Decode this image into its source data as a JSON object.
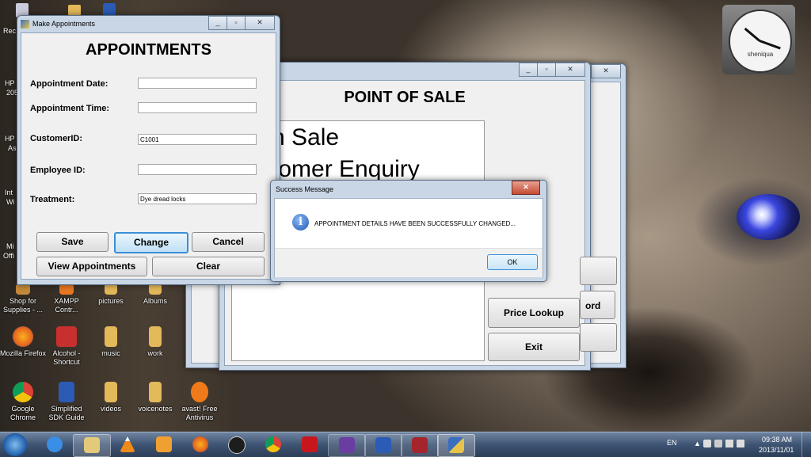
{
  "desktop": {
    "left_edge_labels": [
      "Rec",
      "HP",
      "205",
      "HP",
      "As",
      "Int",
      "Wi",
      "Mi",
      "Offi"
    ],
    "icons": [
      {
        "label": "Shop for Supplies - ...",
        "color": "#c58a3a"
      },
      {
        "label": "XAMPP Contr...",
        "color": "#e87722"
      },
      {
        "label": "pictures",
        "color": "#e3b95a"
      },
      {
        "label": "Albums",
        "color": "#e3b95a"
      },
      {
        "label": "Mozilla Firefox",
        "color": "#e8661e"
      },
      {
        "label": "Alcohol - Shortcut",
        "color": "#c83030"
      },
      {
        "label": "music",
        "color": "#e3b95a"
      },
      {
        "label": "work",
        "color": "#e3b95a"
      },
      {
        "label": "Google Chrome",
        "color": "#3a9a3a"
      },
      {
        "label": "Simplified SDK Guide",
        "color": "#2b5bb5"
      },
      {
        "label": "videos",
        "color": "#e3b95a"
      },
      {
        "label": "voicenotes",
        "color": "#e3b95a"
      },
      {
        "label": "avast! Free Antivirus",
        "color": "#f07a1a"
      }
    ],
    "clock_gadget_label": "sheniqua"
  },
  "appointments_window": {
    "title": "Make Appointments",
    "heading": "APPOINTMENTS",
    "fields": {
      "appointment_date": {
        "label": "Appointment Date:",
        "value": ""
      },
      "appointment_time": {
        "label": "Appointment Time:",
        "value": ""
      },
      "customer_id": {
        "label": "CustomerID:",
        "value": "C1001"
      },
      "employee_id": {
        "label": "Employee ID:",
        "value": ""
      },
      "treatment": {
        "label": "Treatment:",
        "value": "Dye dread locks"
      }
    },
    "buttons": {
      "save": "Save",
      "change": "Change",
      "cancel": "Cancel",
      "view": "View Appointments",
      "clear": "Clear"
    }
  },
  "pos_window": {
    "heading": "POINT OF SALE",
    "menu_line1": "n Sale",
    "menu_line2": "tomer Enquiry",
    "buttons": {
      "price_lookup": "Price Lookup",
      "exit": "Exit",
      "partial_ord": "ord"
    }
  },
  "message_box": {
    "title": "Success Message",
    "message": "APPOINTMENT DETAILS HAVE BEEN SUCCESSFULLY CHANGED...",
    "ok": "OK"
  },
  "taskbar": {
    "language": "EN",
    "time": "09:38 AM",
    "date": "2013/11/01"
  }
}
